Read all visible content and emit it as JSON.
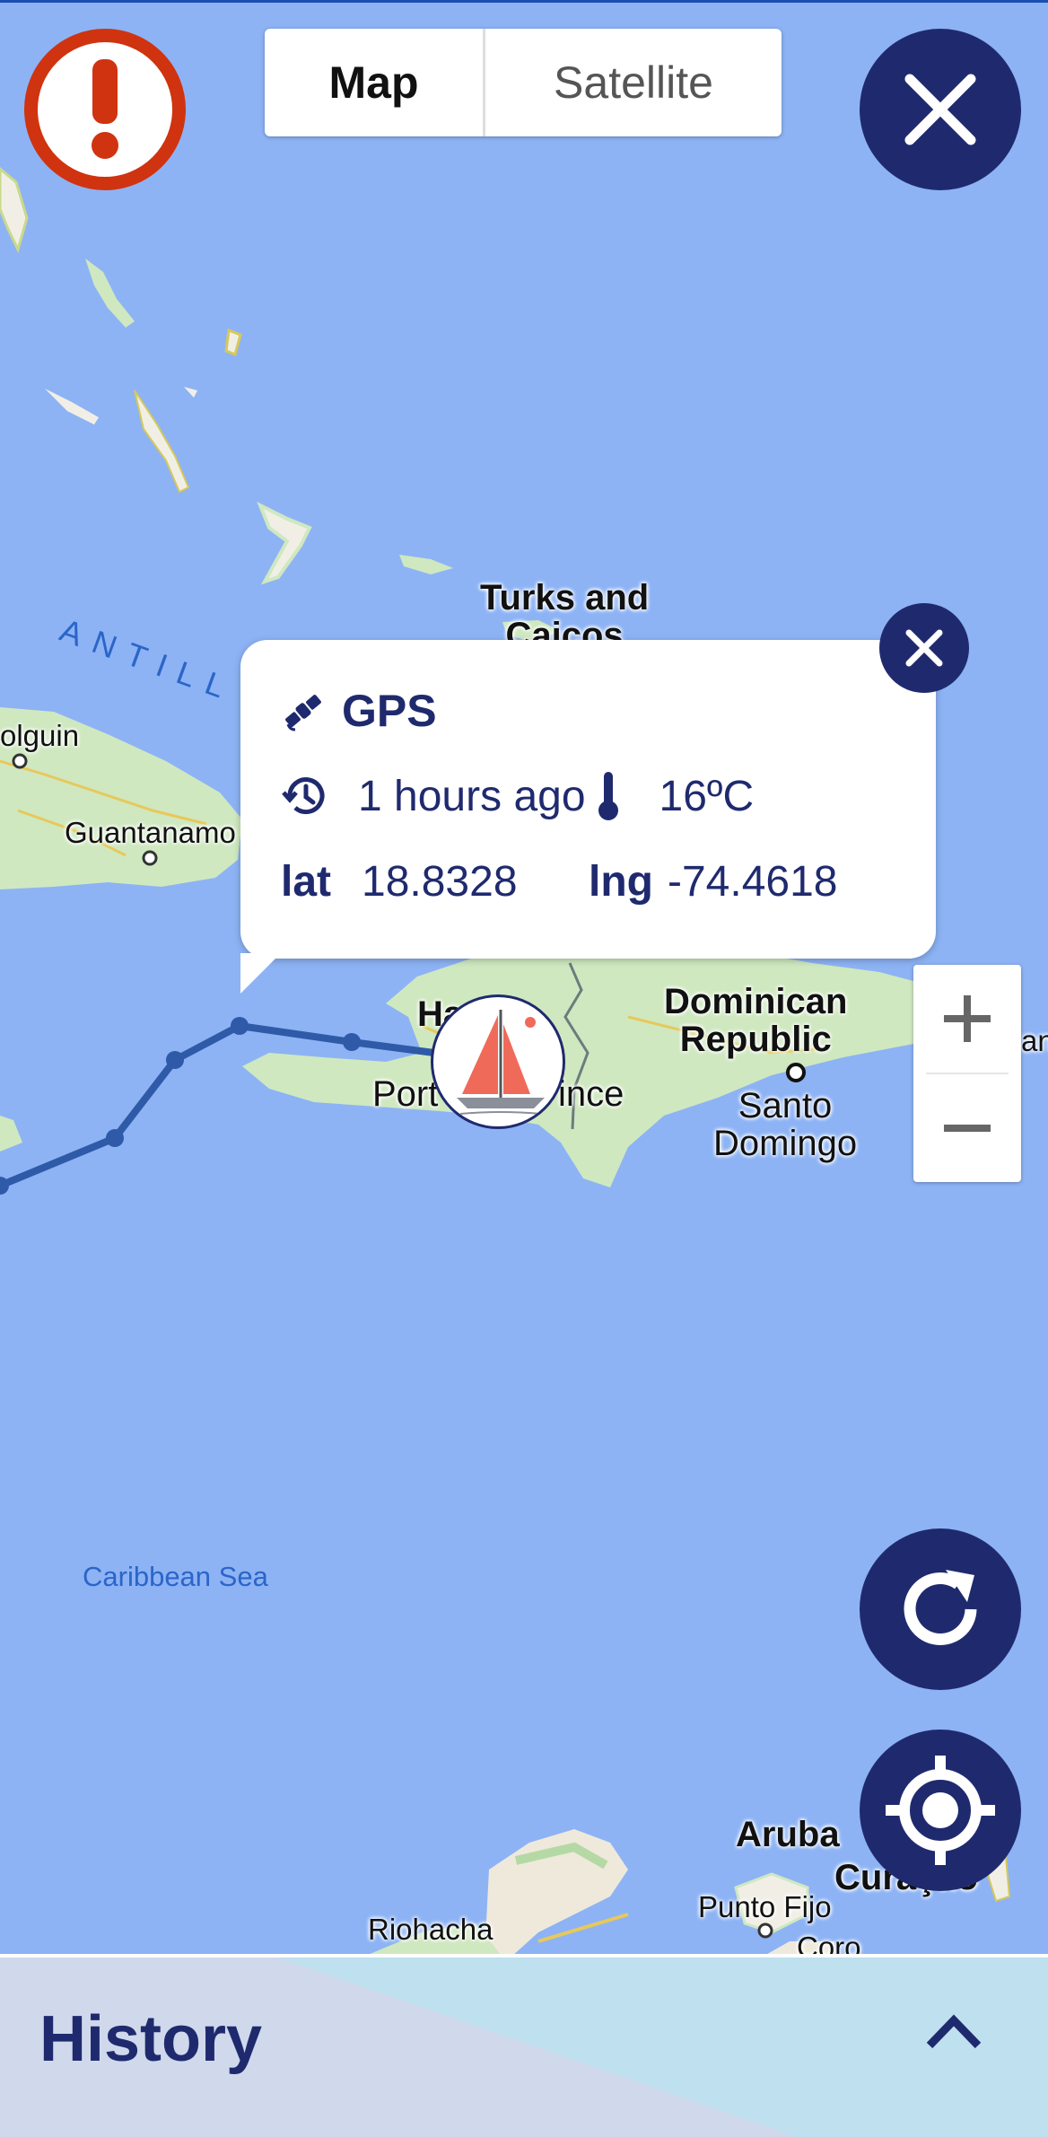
{
  "map_type": {
    "map_label": "Map",
    "satellite_label": "Satellite",
    "selected": "Map"
  },
  "map_labels": {
    "turks_line1": "Turks and",
    "turks_line2": "Caicos",
    "antilles_partial": "ANTILL",
    "holguin_partial": "olguin",
    "guantanamo": "Guantanamo",
    "haiti_partial": "Ha",
    "port_prefix": "Port",
    "port_suffix": "ince",
    "dominican_line1": "Dominican",
    "dominican_line2": "Republic",
    "santo_line1": "Santo",
    "santo_line2": "Domingo",
    "edge_partial": "an",
    "caribbean_sea": "Caribbean Sea",
    "aruba": "Aruba",
    "curacao_partial": "Curaçao",
    "punto_fijo": "Punto Fijo",
    "coro_partial": "Coro",
    "riohacha": "Riohacha"
  },
  "popup": {
    "source": "GPS",
    "time_ago": "1 hours ago",
    "temperature": "16ºC",
    "lat_label": "lat",
    "lat_value": "18.8328",
    "lng_label": "lng",
    "lng_value": "-74.4618"
  },
  "history": {
    "title": "History"
  },
  "colors": {
    "navy": "#1f2a6e",
    "alert_red": "#d0330f",
    "sea": "#8db3f5",
    "land": "#cfe8cf",
    "track": "#2f5aa8"
  },
  "icons": {
    "alert": "exclamation-circle-icon",
    "close": "close-icon",
    "refresh": "refresh-icon",
    "locate": "crosshair-icon",
    "zoom_in": "plus-icon",
    "zoom_out": "minus-icon",
    "satellite": "satellite-icon",
    "history": "history-clock-icon",
    "thermometer": "thermometer-icon",
    "boat": "sailboat-icon",
    "expand": "chevron-up-icon"
  }
}
